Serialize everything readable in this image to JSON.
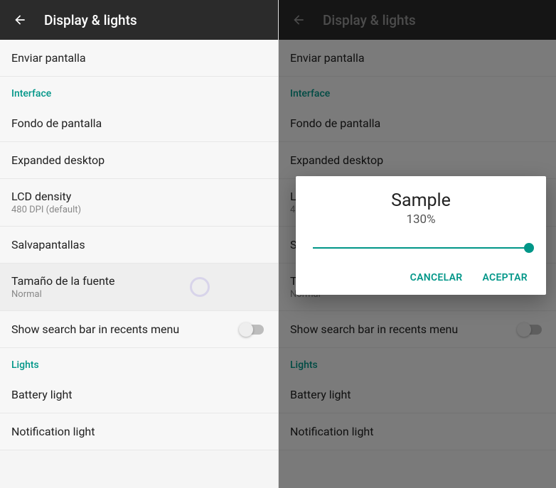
{
  "left": {
    "appbar": {
      "title": "Display & lights"
    },
    "items": {
      "enviar": "Enviar pantalla",
      "interface_header": "Interface",
      "fondo": "Fondo de pantalla",
      "expanded": "Expanded desktop",
      "lcd_title": "LCD density",
      "lcd_sub": "480 DPI (default)",
      "salva": "Salvapantallas",
      "tamano_title": "Tamaño de la fuente",
      "tamano_sub": "Normal",
      "showsearch": "Show search bar in recents menu",
      "lights_header": "Lights",
      "battery": "Battery light",
      "notification": "Notification light"
    }
  },
  "right": {
    "appbar": {
      "title": "Display & lights"
    },
    "items": {
      "enviar": "Enviar pantalla",
      "interface_header": "Interface",
      "fondo": "Fondo de pantalla",
      "expanded": "Expanded desktop",
      "lcd_title": "L",
      "lcd_sub": "4",
      "salva": "S",
      "tamano_title": "Tamaño de la fuente",
      "tamano_sub": "Normal",
      "showsearch": "Show search bar in recents menu",
      "lights_header": "Lights",
      "battery": "Battery light",
      "notification": "Notification light"
    },
    "dialog": {
      "title": "Sample",
      "percent": "130%",
      "cancel": "Cancelar",
      "accept": "Aceptar"
    }
  }
}
